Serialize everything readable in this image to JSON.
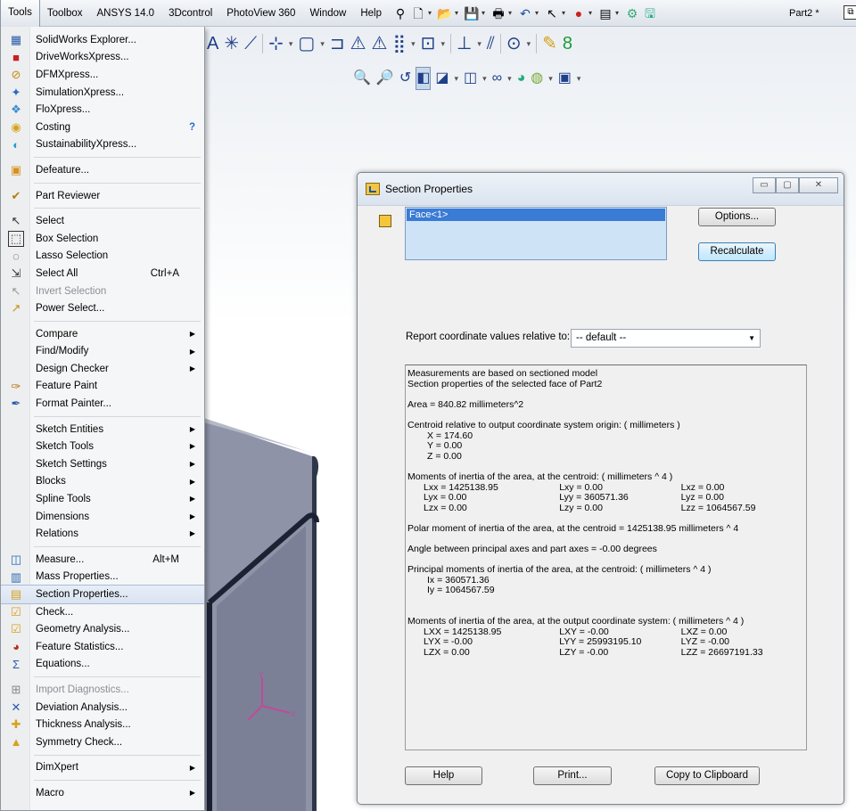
{
  "menubar": {
    "items": [
      "Tools",
      "Toolbox",
      "ANSYS 14.0",
      "3Dcontrol",
      "PhotoView 360",
      "Window",
      "Help"
    ],
    "doc_title": "Part2 *"
  },
  "tools_menu": {
    "items": [
      {
        "label": "SolidWorks Explorer...",
        "icon": "explorer-icon"
      },
      {
        "label": "DriveWorksXpress...",
        "icon": "driveworks-icon"
      },
      {
        "label": "DFMXpress...",
        "icon": "dfm-icon"
      },
      {
        "label": "SimulationXpress...",
        "icon": "simulation-icon"
      },
      {
        "label": "FloXpress...",
        "icon": "flo-icon"
      },
      {
        "label": "Costing",
        "icon": "costing-icon",
        "extra": "?"
      },
      {
        "label": "SustainabilityXpress...",
        "icon": "sustainability-icon"
      },
      {
        "sep": true
      },
      {
        "label": "Defeature...",
        "icon": "defeature-icon"
      },
      {
        "sep": true
      },
      {
        "label": "Part Reviewer",
        "icon": "reviewer-icon"
      },
      {
        "sep": true
      },
      {
        "label": "Select",
        "icon": "cursor-icon"
      },
      {
        "label": "Box Selection",
        "icon": "box-selection-icon"
      },
      {
        "label": "Lasso Selection",
        "icon": "lasso-icon"
      },
      {
        "label": "Select All",
        "icon": "select-all-icon",
        "shortcut": "Ctrl+A"
      },
      {
        "label": "Invert Selection",
        "icon": "invert-selection-icon",
        "disabled": true
      },
      {
        "label": "Power Select...",
        "icon": "power-select-icon"
      },
      {
        "sep": true
      },
      {
        "label": "Compare",
        "submenu": true
      },
      {
        "label": "Find/Modify",
        "submenu": true
      },
      {
        "label": "Design Checker",
        "submenu": true
      },
      {
        "label": "Feature Paint",
        "icon": "feature-paint-icon"
      },
      {
        "label": "Format Painter...",
        "icon": "format-painter-icon"
      },
      {
        "sep": true
      },
      {
        "label": "Sketch Entities",
        "submenu": true
      },
      {
        "label": "Sketch Tools",
        "submenu": true
      },
      {
        "label": "Sketch Settings",
        "submenu": true
      },
      {
        "label": "Blocks",
        "submenu": true
      },
      {
        "label": "Spline Tools",
        "submenu": true
      },
      {
        "label": "Dimensions",
        "submenu": true
      },
      {
        "label": "Relations",
        "submenu": true
      },
      {
        "sep": true
      },
      {
        "label": "Measure...",
        "icon": "measure-icon",
        "shortcut": "Alt+M"
      },
      {
        "label": "Mass Properties...",
        "icon": "mass-properties-icon"
      },
      {
        "label": "Section Properties...",
        "icon": "section-properties-icon",
        "highlight": true
      },
      {
        "label": "Check...",
        "icon": "check-icon"
      },
      {
        "label": "Geometry Analysis...",
        "icon": "geometry-analysis-icon"
      },
      {
        "label": "Feature Statistics...",
        "icon": "feature-statistics-icon"
      },
      {
        "label": "Equations...",
        "icon": "equations-icon"
      },
      {
        "sep": true
      },
      {
        "label": "Import Diagnostics...",
        "icon": "import-diagnostics-icon",
        "disabled": true
      },
      {
        "label": "Deviation  Analysis...",
        "icon": "deviation-icon"
      },
      {
        "label": "Thickness Analysis...",
        "icon": "thickness-icon"
      },
      {
        "label": "Symmetry Check...",
        "icon": "symmetry-icon"
      },
      {
        "sep": true
      },
      {
        "label": "DimXpert",
        "submenu": true
      },
      {
        "sep": true
      },
      {
        "label": "Macro",
        "submenu": true
      }
    ]
  },
  "dialog": {
    "title": "Section Properties",
    "face_item": "Face<1>",
    "options_label": "Options...",
    "recalculate_label": "Recalculate",
    "report_label": "Report coordinate values relative to:",
    "coord_select": "-- default --",
    "help_label": "Help",
    "print_label": "Print...",
    "copy_label": "Copy to Clipboard",
    "results": {
      "line1": "Measurements are based on sectioned model",
      "line2": "Section properties of the selected face of Part2",
      "area": "Area = 840.82 millimeters^2",
      "centroid_head": "Centroid relative to output coordinate system origin: ( millimeters )",
      "cx": "X = 174.60",
      "cy": "Y = 0.00",
      "cz": "Z = 0.00",
      "moi_head": "Moments of inertia of the area, at the centroid: ( millimeters ^ 4 )",
      "moi": [
        [
          "Lxx = 1425138.95",
          "Lxy = 0.00",
          "Lxz = 0.00"
        ],
        [
          "Lyx = 0.00",
          "Lyy = 360571.36",
          "Lyz = 0.00"
        ],
        [
          "Lzx = 0.00",
          "Lzy = 0.00",
          "Lzz = 1064567.59"
        ]
      ],
      "polar": "Polar moment of inertia of the area, at the centroid = 1425138.95 millimeters ^ 4",
      "angle": "Angle between principal axes and part axes = -0.00 degrees",
      "principal_head": "Principal moments of inertia of the area, at the centroid: ( millimeters ^ 4 )",
      "ix": "Ix = 360571.36",
      "iy": "Iy = 1064567.59",
      "out_head": "Moments of inertia of the area, at the output coordinate system: ( millimeters ^ 4 )",
      "out": [
        [
          "LXX = 1425138.95",
          "LXY = -0.00",
          "LXZ = 0.00"
        ],
        [
          "LYX = -0.00",
          "LYY = 25993195.10",
          "LYZ = -0.00"
        ],
        [
          "LZX = 0.00",
          "LZY = -0.00",
          "LZZ = 26697191.33"
        ]
      ]
    }
  }
}
